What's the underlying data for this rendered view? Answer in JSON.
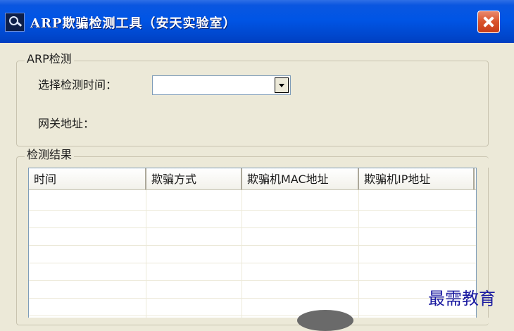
{
  "window": {
    "title": "ARP欺骗检测工具（安天实验室）"
  },
  "arp_group": {
    "label": "ARP检测",
    "select_time_label": "选择检测时间：",
    "select_time_value": "",
    "gateway_label": "网关地址："
  },
  "results_group": {
    "label": "检测结果",
    "columns": [
      "时间",
      "欺骗方式",
      "欺骗机MAC地址",
      "欺骗机IP地址"
    ]
  },
  "watermark": "最需教育"
}
